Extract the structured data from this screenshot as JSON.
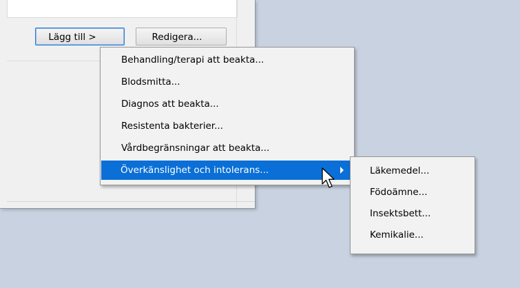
{
  "window": {
    "add_button_label": "Lägg till >",
    "edit_button_label": "Redigera..."
  },
  "context_menu": {
    "items": [
      {
        "label": "Behandling/terapi att beakta..."
      },
      {
        "label": "Blodsmitta..."
      },
      {
        "label": "Diagnos att beakta..."
      },
      {
        "label": "Resistenta bakterier..."
      },
      {
        "label": "Vårdbegränsningar att beakta..."
      },
      {
        "label": "Överkänslighet och intolerans...",
        "active": true,
        "has_submenu": true
      }
    ]
  },
  "submenu": {
    "items": [
      {
        "label": "Läkemedel..."
      },
      {
        "label": "Födoämne..."
      },
      {
        "label": "Insektsbett..."
      },
      {
        "label": "Kemikalie..."
      }
    ]
  },
  "colors": {
    "desktop": "#c9d2e0",
    "highlight": "#0a6fd6",
    "menu_bg": "#f2f2f2"
  },
  "icons": {
    "submenu_arrow": "chevron-right-icon",
    "cursor": "mouse-pointer-icon"
  }
}
